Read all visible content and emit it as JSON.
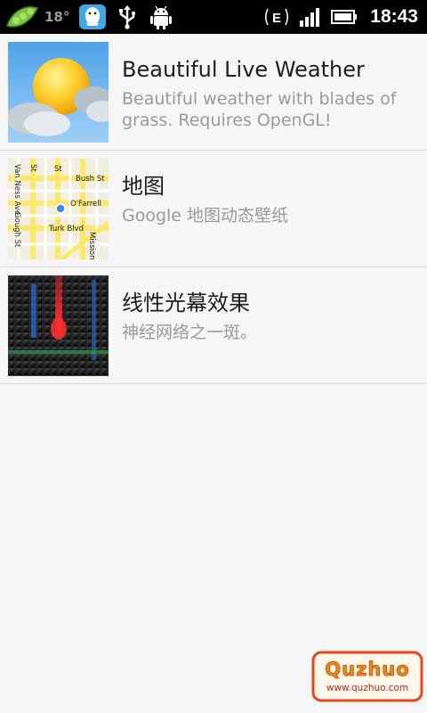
{
  "status_bar": {
    "icons_left": [
      "peapod-icon",
      "temperature",
      "qq-notification-icon",
      "usb-icon",
      "android-debug-icon"
    ],
    "temperature": "18°",
    "network_type": "E",
    "time": "18:43"
  },
  "wallpapers": [
    {
      "title": "Beautiful Live Weather",
      "description": "Beautiful weather with blades of grass. Requires OpenGL!",
      "thumbnail": "weather-sun-cloud"
    },
    {
      "title": "地图",
      "description": "Google 地图动态壁纸",
      "thumbnail": "map",
      "map_labels": [
        "Bush St",
        "Van Ness Ave",
        "O'Farrell",
        "Turk Blvd",
        "Gough St",
        "Mission",
        "St",
        "St"
      ]
    },
    {
      "title": "线性光幕效果",
      "description": "神经网络之一斑。",
      "thumbnail": "neural-grid"
    }
  ],
  "watermark": {
    "brand": "Quzhuo",
    "url": "www.quzhuo.com"
  }
}
